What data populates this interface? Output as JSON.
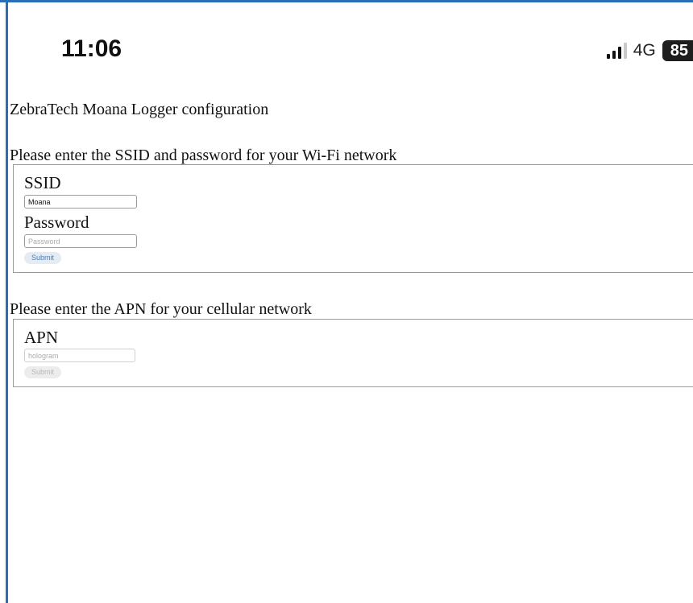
{
  "status_bar": {
    "time": "11:06",
    "network": "4G",
    "battery": "85"
  },
  "page": {
    "title": "ZebraTech Moana Logger configuration"
  },
  "wifi_section": {
    "prompt": "Please enter the SSID and password for your Wi-Fi network",
    "ssid_label": "SSID",
    "ssid_value": "Moana",
    "password_label": "Password",
    "password_placeholder": "Password",
    "submit_label": "Submit"
  },
  "apn_section": {
    "prompt": "Please enter the APN for your cellular network",
    "apn_label": "APN",
    "apn_placeholder": "hologram",
    "submit_label": "Submit"
  },
  "colors": {
    "frame": "#2a6db8",
    "submit_text": "#4a7fb8",
    "submit_bg": "#e5ebf2"
  }
}
